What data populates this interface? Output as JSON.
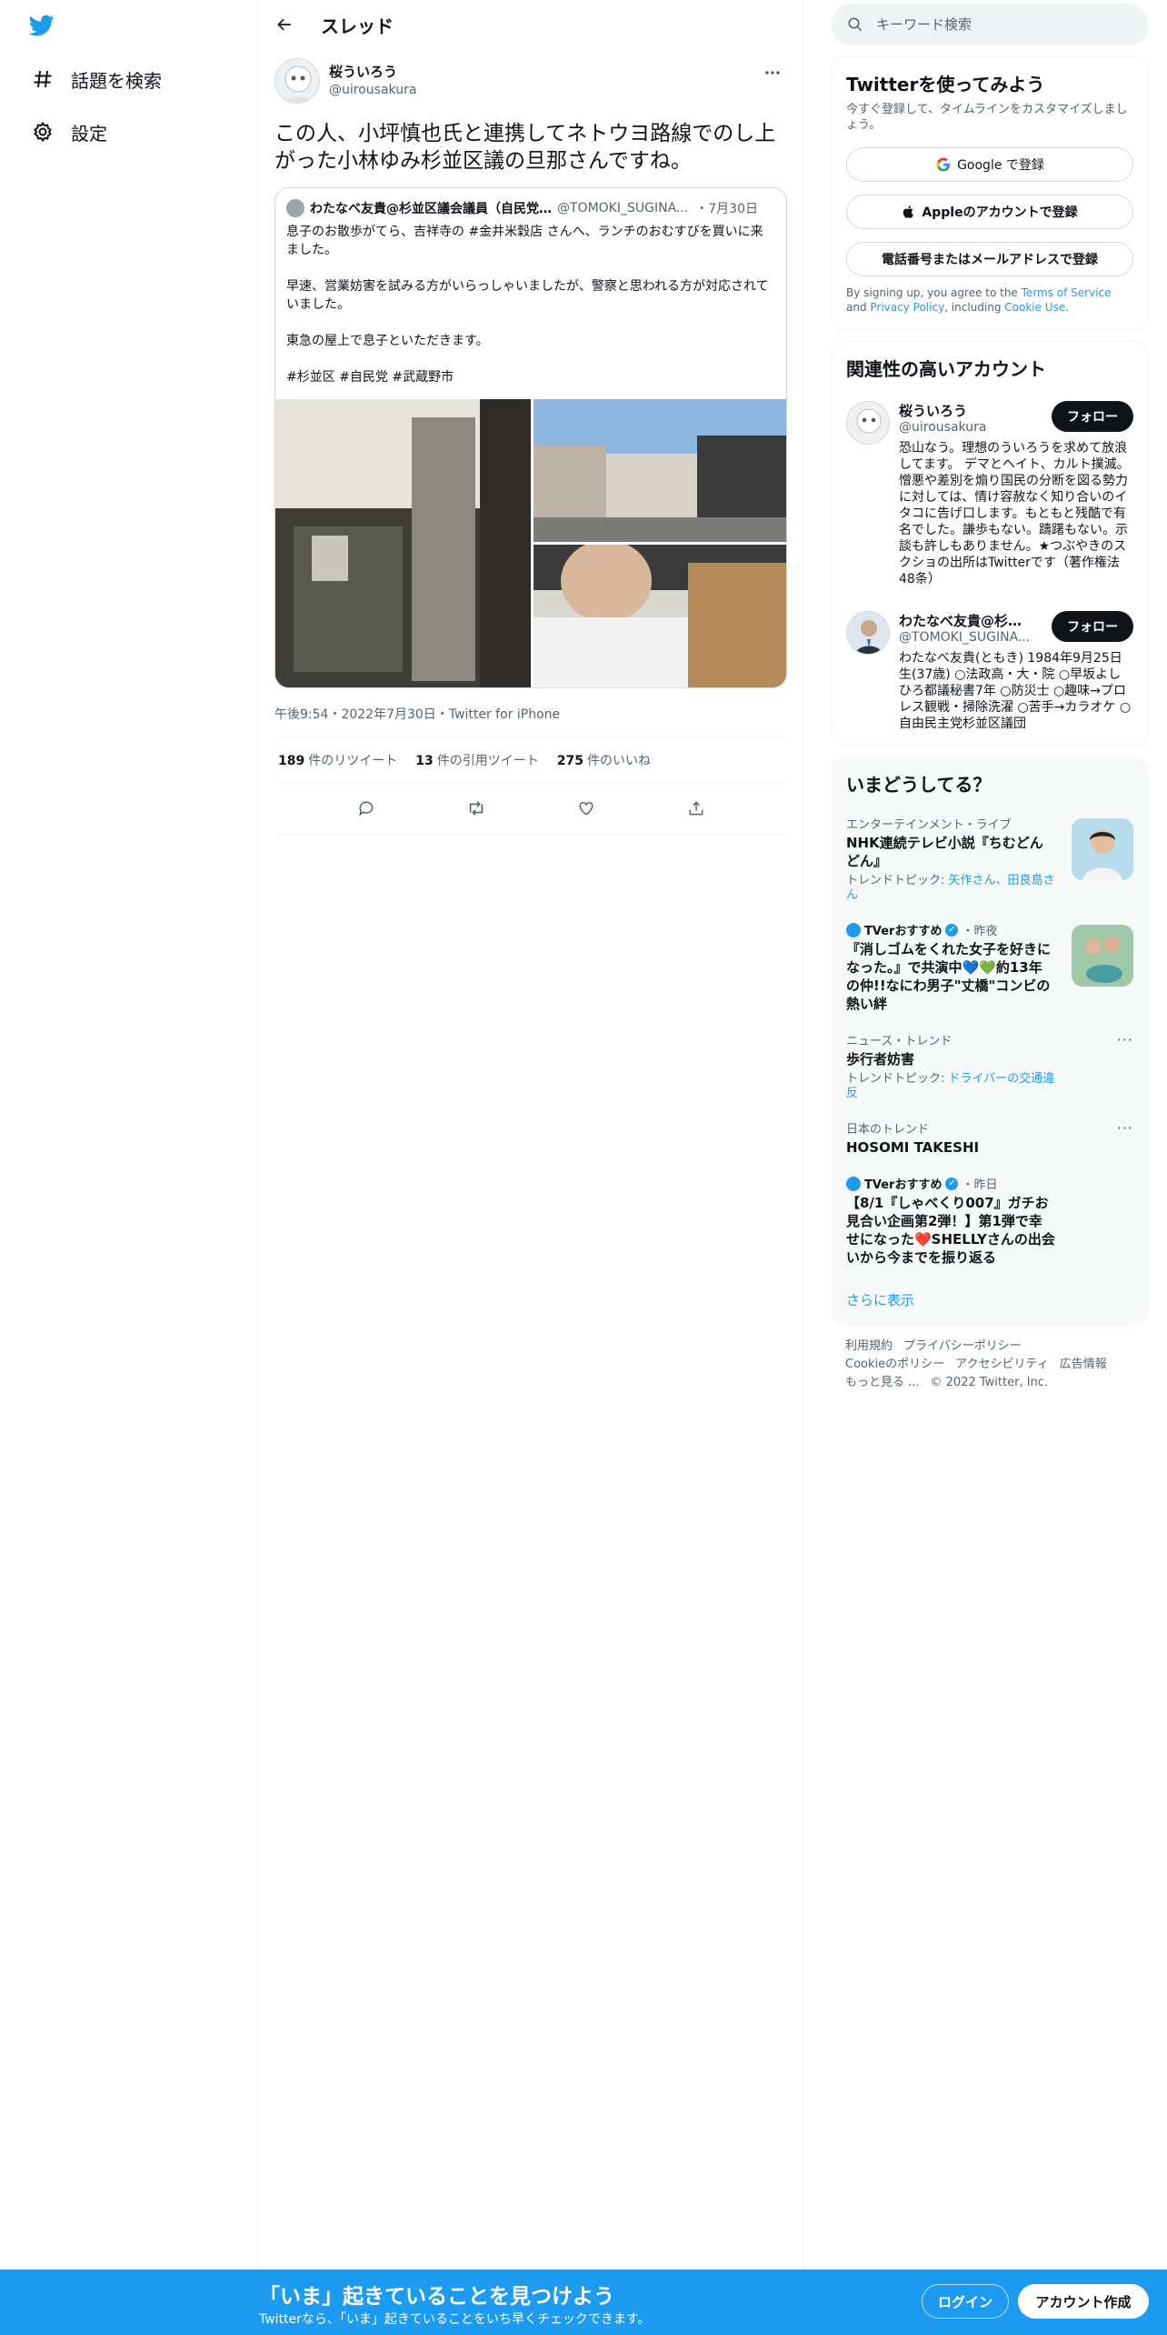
{
  "nav": {
    "explore_label": "話題を検索",
    "settings_label": "設定"
  },
  "header": {
    "title": "スレッド"
  },
  "tweet": {
    "author_name": "桜ういろう",
    "author_handle": "@uirousakura",
    "text": "この人、小坪慎也氏と連携してネトウヨ路線でのし上がった小林ゆみ杉並区議の旦那さんですね。",
    "quote": {
      "name": "わたなべ友貴@杉並区議会議員（自民党…",
      "handle": "@TOMOKI_SUGINA...",
      "date": "・7月30日",
      "para1": "息子のお散歩がてら、吉祥寺の #金井米穀店 さんへ、ランチのおむすびを買いに来ました。",
      "para2": "早速、営業妨害を試みる方がいらっしゃいましたが、警察と思われる方が対応されていました。",
      "para3": "東急の屋上で息子といただきます。",
      "para4": "#杉並区  #自民党 #武蔵野市"
    },
    "meta": "午後9:54・2022年7月30日・Twitter for iPhone",
    "stats": {
      "retweets": "189",
      "retweets_label": "件のリツイート",
      "quotes": "13",
      "quotes_label": "件の引用ツイート",
      "likes": "275",
      "likes_label": "件のいいね"
    }
  },
  "search": {
    "placeholder": "キーワード検索"
  },
  "signup": {
    "title": "Twitterを使ってみよう",
    "subtitle": "今すぐ登録して、タイムラインをカスタマイズしましょう。",
    "google": "Google で登録",
    "apple": "Appleのアカウントで登録",
    "phone": "電話番号またはメールアドレスで登録",
    "terms_prefix": "By signing up, you agree to the ",
    "terms_link": "Terms of Service",
    "terms_mid": " and ",
    "privacy_link": "Privacy Policy",
    "terms_mid2": ", including ",
    "cookie_link": "Cookie Use",
    "terms_end": "."
  },
  "relevant": {
    "title": "関連性の高いアカウント",
    "follow_label": "フォロー",
    "accounts": [
      {
        "name": "桜ういろう",
        "handle": "@uirousakura",
        "bio": "恐山なう。理想のういろうを求めて放浪してます。 デマとヘイト、カルト撲滅。憎悪や差別を煽り国民の分断を図る勢力に対しては、情け容赦なく知り合いのイタコに告げ口します。もともと残酷で有名でした。謙歩もない。躊躇もない。示談も許しもありません。★つぶやきのスクショの出所はTwitterです（著作権法48条）"
      },
      {
        "name": "わたなべ友貴@杉並...",
        "handle": "@TOMOKI_SUGINA...",
        "bio": "わたなべ友貴(ともき) 1984年9月25日生(37歳) ○法政高・大・院 ○早坂よしひろ都議秘書7年 ○防災士 ○趣味→プロレス観戦・掃除洗濯 ○苦手→カラオケ ○自由民主党杉並区議団"
      }
    ]
  },
  "trends": {
    "title": "いまどうしてる？",
    "items": [
      {
        "context": "エンターテインメント・ライブ",
        "title": "NHK連続テレビ小説『ちむどんどん』",
        "topic_prefix": "トレンドトピック: ",
        "topic": "矢作さん、田良島さん"
      },
      {
        "account": "TVerおすすめ",
        "time": "・昨夜",
        "title": "『消しゴムをくれた女子を好きになった。』で共演中💙💚約13年の仲!!なにわ男子\"丈橋\"コンビの熱い絆"
      },
      {
        "context": "ニュース・トレンド",
        "title": "歩行者妨害",
        "topic_prefix": "トレンドトピック: ",
        "topic": "ドライバーの交通違反"
      },
      {
        "context": "日本のトレンド",
        "title": "HOSOMI TAKESHI"
      },
      {
        "account": "TVerおすすめ",
        "time": "・昨日",
        "title": "【8/1『しゃべくり007』ガチお見合い企画第2弾！】第1弾で幸せになった❤️SHELLYさんの出会いから今までを振り返る"
      }
    ],
    "show_more": "さらに表示"
  },
  "footer": {
    "terms": "利用規約",
    "privacy": "プライバシーポリシー",
    "cookie": "Cookieのポリシー",
    "accessibility": "アクセシビリティ",
    "ads": "広告情報",
    "more": "もっと見る ...",
    "copyright": "© 2022 Twitter, Inc."
  },
  "bottom": {
    "title": "「いま」起きていることを見つけよう",
    "subtitle": "Twitterなら、「いま」起きていることをいち早くチェックできます。",
    "login": "ログイン",
    "signup": "アカウント作成"
  },
  "colors": {
    "accent": "#1d9bf0",
    "text": "#0f1419",
    "muted": "#536471"
  }
}
